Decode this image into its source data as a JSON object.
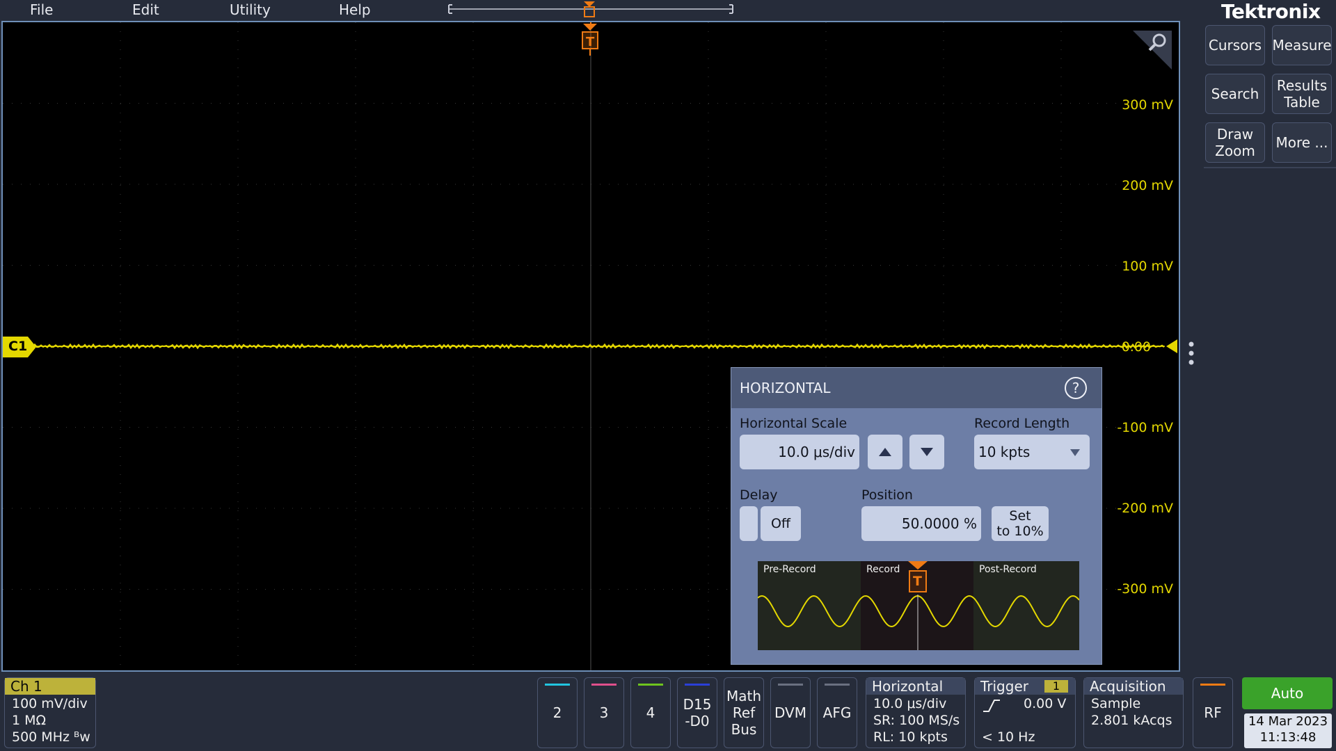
{
  "menu": {
    "items": [
      "File",
      "Edit",
      "Utility",
      "Help"
    ]
  },
  "brand": "Tektronix",
  "graticule": {
    "voltage_labels": [
      "300 mV",
      "200 mV",
      "100 mV",
      "0.00",
      "-100 mV",
      "-200 mV",
      "-300 mV"
    ],
    "channel_marker": "C1",
    "trigger_marker": "T",
    "trace_color": "#e4d800",
    "trigger_color": "#f07b14"
  },
  "right_panel": {
    "buttons": [
      "Cursors",
      "Measure",
      "Search",
      "Results\nTable",
      "Draw\nZoom",
      "More ..."
    ]
  },
  "horizontal_dialog": {
    "title": "HORIZONTAL",
    "scale_label": "Horizontal Scale",
    "scale_value": "10.0 μs/div",
    "record_length_label": "Record Length",
    "record_length_value": "10 kpts",
    "delay_label": "Delay",
    "delay_value": "Off",
    "position_label": "Position",
    "position_value": "50.0000 %",
    "set_button": "Set\nto 10%",
    "diagram": {
      "pre_record": "Pre-Record",
      "record": "Record",
      "post_record": "Post-Record",
      "trigger_marker": "T"
    }
  },
  "bottom": {
    "ch1": {
      "head": "Ch 1",
      "lines": [
        "100 mV/div",
        "1 MΩ",
        "500 MHz ᴮw"
      ],
      "color": "#bdb23a"
    },
    "channel_tiles": [
      {
        "label": "2",
        "color": "#21c5e0"
      },
      {
        "label": "3",
        "color": "#e0508c"
      },
      {
        "label": "4",
        "color": "#6ec41e"
      },
      {
        "label": "D15\n-D0",
        "color": "#2b3fd8"
      }
    ],
    "other_tiles": [
      "Math\nRef\nBus",
      "DVM",
      "AFG"
    ],
    "horizontal": {
      "head": "Horizontal",
      "lines": [
        "10.0 μs/div",
        "SR: 100 MS/s",
        "RL: 10 kpts"
      ]
    },
    "trigger": {
      "head": "Trigger",
      "source": "1",
      "level": "0.00 V",
      "freq": "< 10 Hz"
    },
    "acquisition": {
      "head": "Acquisition",
      "lines": [
        "Sample",
        "2.801 kAcqs"
      ]
    },
    "rf": {
      "label": "RF",
      "color": "#f07b14"
    },
    "run_mode": {
      "label": "Auto",
      "color": "#3aa22a"
    },
    "datetime": {
      "date": "14 Mar 2023",
      "time": "11:13:48"
    }
  }
}
